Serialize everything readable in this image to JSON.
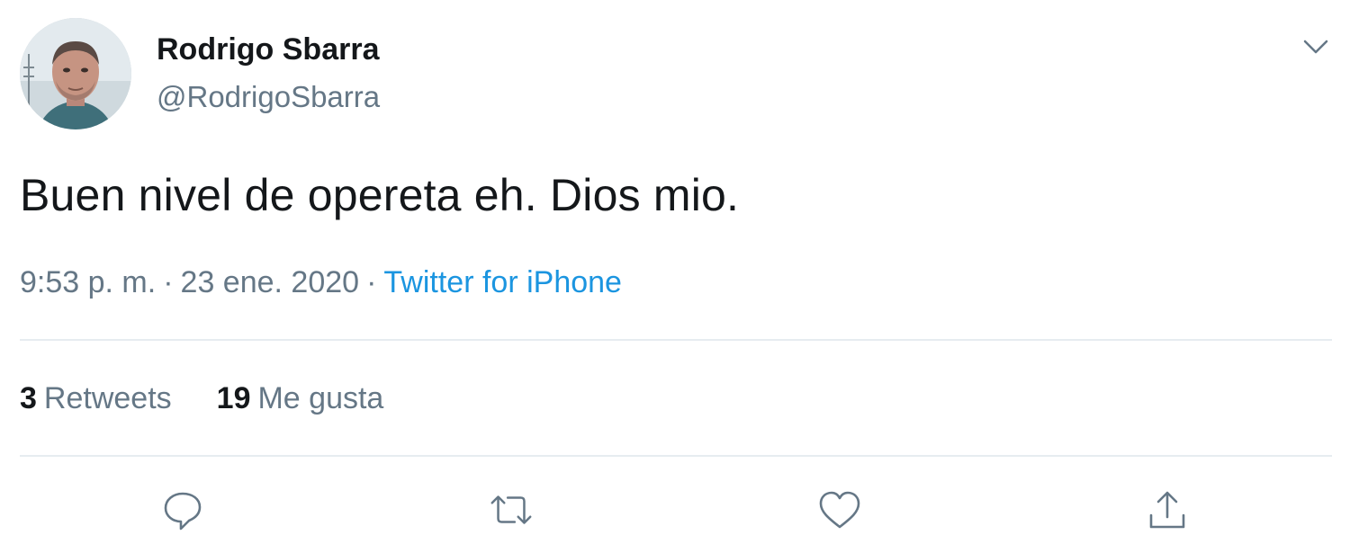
{
  "author": {
    "name": "Rodrigo Sbarra",
    "handle": "@RodrigoSbarra"
  },
  "tweet": {
    "text": "Buen nivel de opereta eh. Dios mio.",
    "time": "9:53 p. m.",
    "date": "23 ene. 2020",
    "separator": "·",
    "source": "Twitter for iPhone"
  },
  "stats": {
    "retweets_count": "3",
    "retweets_label": "Retweets",
    "likes_count": "19",
    "likes_label": "Me gusta"
  },
  "icons": {
    "menu": "chevron-down-icon",
    "reply": "reply-icon",
    "retweet": "retweet-icon",
    "like": "heart-icon",
    "share": "share-icon"
  },
  "colors": {
    "link": "#1b95e0",
    "secondary_text": "#657786",
    "primary_text": "#14171a",
    "divider": "#e6ecf0"
  }
}
